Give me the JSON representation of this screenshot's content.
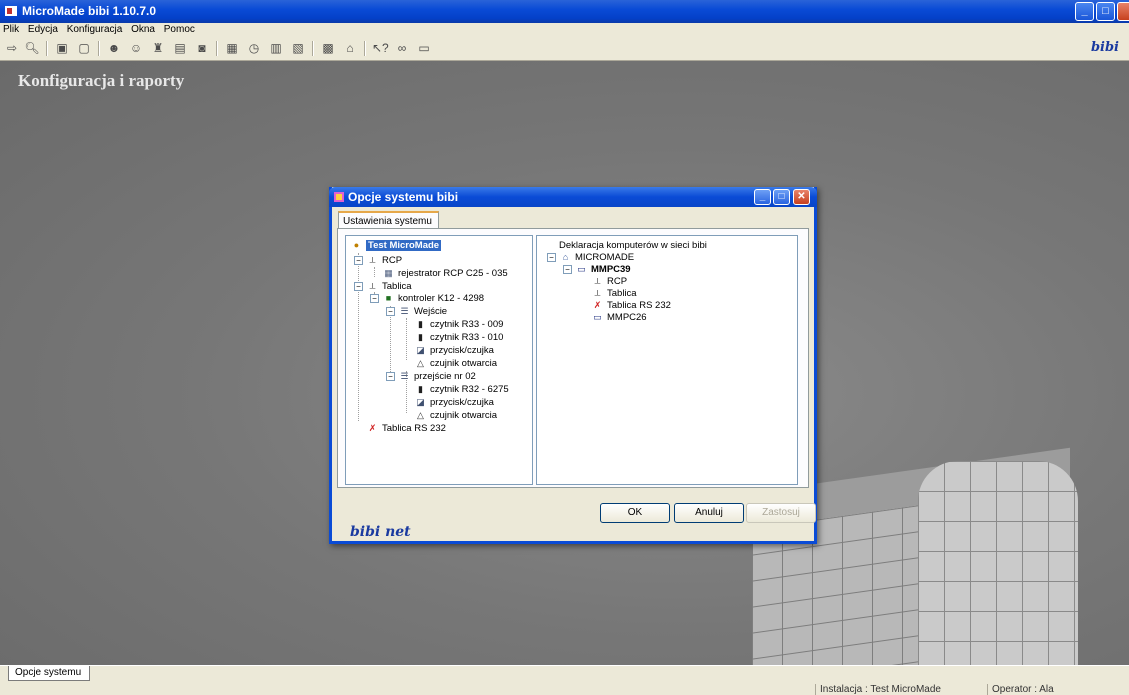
{
  "window": {
    "title": "MicroMade bibi 1.10.7.0",
    "min": "_",
    "max": "□",
    "close": "✕"
  },
  "menu": [
    "Plik",
    "Edycja",
    "Konfiguracja",
    "Okna",
    "Pomoc"
  ],
  "toolbar": {
    "icons": [
      "exit-icon",
      "preview-icon",
      "door-in-icon",
      "door-out-icon",
      "person-icon",
      "people-icon",
      "users-group-icon",
      "report-icon",
      "card-icon",
      "calendar-icon",
      "clock-icon",
      "table-icon",
      "document-icon",
      "database-icon",
      "network-icon",
      "help-pointer-icon",
      "binoculars-icon",
      "monitor-icon"
    ],
    "brand": "bibi"
  },
  "workspace": {
    "title": "Konfiguracja i raporty"
  },
  "dialog": {
    "title": "Opcje systemu bibi",
    "tab": "Ustawienia systemu",
    "left_tree": [
      {
        "label": "Test MicroMade",
        "icon": "system-icon",
        "level": 0,
        "selected": true
      },
      {
        "label": "RCP",
        "icon": "rcp-icon",
        "level": 1
      },
      {
        "label": "rejestrator RCP C25 - 035",
        "icon": "recorder-icon",
        "level": 2
      },
      {
        "label": "Tablica",
        "icon": "rcp-icon",
        "level": 1
      },
      {
        "label": "kontroler K12 - 4298",
        "icon": "controller-icon",
        "level": 2
      },
      {
        "label": "Wejście",
        "icon": "door-icon",
        "level": 3
      },
      {
        "label": "czytnik R33 - 009",
        "icon": "reader-icon",
        "level": 4
      },
      {
        "label": "czytnik R33 - 010",
        "icon": "reader-icon",
        "level": 4
      },
      {
        "label": "przycisk/czujka",
        "icon": "button-sensor-icon",
        "level": 4
      },
      {
        "label": "czujnik otwarcia",
        "icon": "opening-sensor-icon",
        "level": 4
      },
      {
        "label": "przejście nr 02",
        "icon": "door-icon",
        "level": 3
      },
      {
        "label": "czytnik R32 - 6275",
        "icon": "reader-icon",
        "level": 4
      },
      {
        "label": "przycisk/czujka",
        "icon": "button-sensor-icon",
        "level": 4
      },
      {
        "label": "czujnik otwarcia",
        "icon": "opening-sensor-icon",
        "level": 4
      },
      {
        "label": "Tablica RS 232",
        "icon": "rs232-icon",
        "level": 1
      }
    ],
    "right_header": "Deklaracja komputerów w sieci bibi",
    "right_tree": [
      {
        "label": "MICROMADE",
        "icon": "network-icon",
        "level": 0
      },
      {
        "label": "MMPC39",
        "icon": "computer-icon",
        "level": 1,
        "bold": true
      },
      {
        "label": "RCP",
        "icon": "rcp-icon",
        "level": 2
      },
      {
        "label": "Tablica",
        "icon": "rcp-icon",
        "level": 2
      },
      {
        "label": "Tablica RS 232",
        "icon": "rs232-icon",
        "level": 2
      },
      {
        "label": "MMPC26",
        "icon": "computer-icon",
        "level": 2
      }
    ],
    "buttons": {
      "ok": "OK",
      "cancel": "Anuluj",
      "apply": "Zastosuj"
    },
    "brand": "bibi net"
  },
  "bottom_tabs": [
    "Opcje systemu"
  ],
  "status": {
    "installation": "Instalacja : Test MicroMade",
    "operator": "Operator : Ala"
  }
}
